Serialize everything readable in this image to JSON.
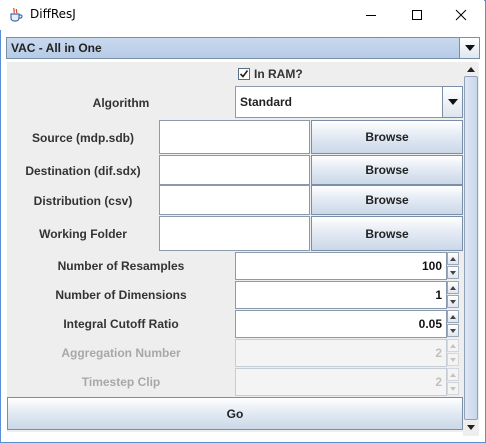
{
  "window": {
    "title": "DiffResJ"
  },
  "profile_combo": {
    "selected": "VAC - All in One"
  },
  "in_ram": {
    "label": "In RAM?",
    "checked": true
  },
  "algorithm": {
    "label": "Algorithm",
    "selected": "Standard"
  },
  "file_rows": [
    {
      "label": "Source (mdp.sdb)",
      "value": "",
      "button": "Browse"
    },
    {
      "label": "Destination (dif.sdx)",
      "value": "",
      "button": "Browse"
    },
    {
      "label": "Distribution (csv)",
      "value": "",
      "button": "Browse"
    },
    {
      "label": "Working Folder",
      "value": "",
      "button": "Browse"
    }
  ],
  "spinner_rows": [
    {
      "label": "Number of Resamples",
      "value": "100",
      "enabled": true
    },
    {
      "label": "Number of Dimensions",
      "value": "1",
      "enabled": true
    },
    {
      "label": "Integral Cutoff Ratio",
      "value": "0.05",
      "enabled": true
    },
    {
      "label": "Aggregation Number",
      "value": "2",
      "enabled": false
    },
    {
      "label": "Timestep Clip",
      "value": "2",
      "enabled": false
    }
  ],
  "go_button": {
    "label": "Go"
  },
  "icons": {
    "app": "coffee-cup-icon",
    "minimize": "minimize-icon",
    "maximize": "maximize-icon",
    "close": "close-icon",
    "dropdown": "triangle-down-icon",
    "check": "checkmark-icon",
    "spinner_up": "arrow-up-icon",
    "spinner_down": "arrow-down-icon"
  },
  "colors": {
    "window_border": "#5a8fd6",
    "combo_fill": "#c9d9ee",
    "button_gradient_bottom": "#cbd8e8",
    "disabled_text": "#a8a8a8"
  }
}
